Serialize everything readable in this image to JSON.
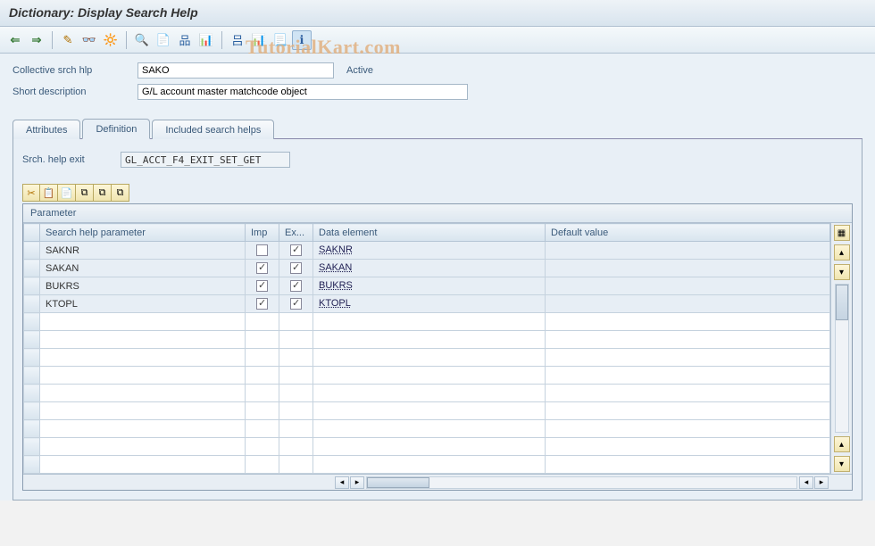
{
  "title": "Dictionary: Display Search Help",
  "watermark": "TutorialKart.com",
  "header": {
    "collective_label": "Collective srch hlp",
    "collective_value": "SAKO",
    "status": "Active",
    "shortdesc_label": "Short description",
    "shortdesc_value": "G/L account master matchcode object"
  },
  "tabs": {
    "attributes": "Attributes",
    "definition": "Definition",
    "included": "Included search helps"
  },
  "exit": {
    "label": "Srch. help exit",
    "value": "GL_ACCT_F4_EXIT_SET_GET"
  },
  "grid": {
    "title": "Parameter",
    "columns": {
      "param": "Search help parameter",
      "imp": "Imp",
      "exp": "Ex...",
      "elem": "Data element",
      "default": "Default value"
    },
    "rows": [
      {
        "param": "SAKNR",
        "imp": false,
        "exp": true,
        "elem": "SAKNR",
        "default": ""
      },
      {
        "param": "SAKAN",
        "imp": true,
        "exp": true,
        "elem": "SAKAN",
        "default": ""
      },
      {
        "param": "BUKRS",
        "imp": true,
        "exp": true,
        "elem": "BUKRS",
        "default": ""
      },
      {
        "param": "KTOPL",
        "imp": true,
        "exp": true,
        "elem": "KTOPL",
        "default": ""
      }
    ]
  },
  "icons": {
    "back": "⇐",
    "forward": "⇒",
    "pencil": "✎",
    "glasses": "👓",
    "activate": "🔆",
    "where": "🔍",
    "other": "📄",
    "hierarchy": "品",
    "graph": "📊",
    "tree": "吕",
    "doc": "📃",
    "help": "ℹ",
    "cut": "✂",
    "copy": "📋",
    "paste": "📄",
    "insert": "➕",
    "delete": "➖",
    "dup": "⧉",
    "settings": "▦",
    "up": "▴",
    "down": "▾",
    "left": "◂",
    "right": "▸"
  }
}
